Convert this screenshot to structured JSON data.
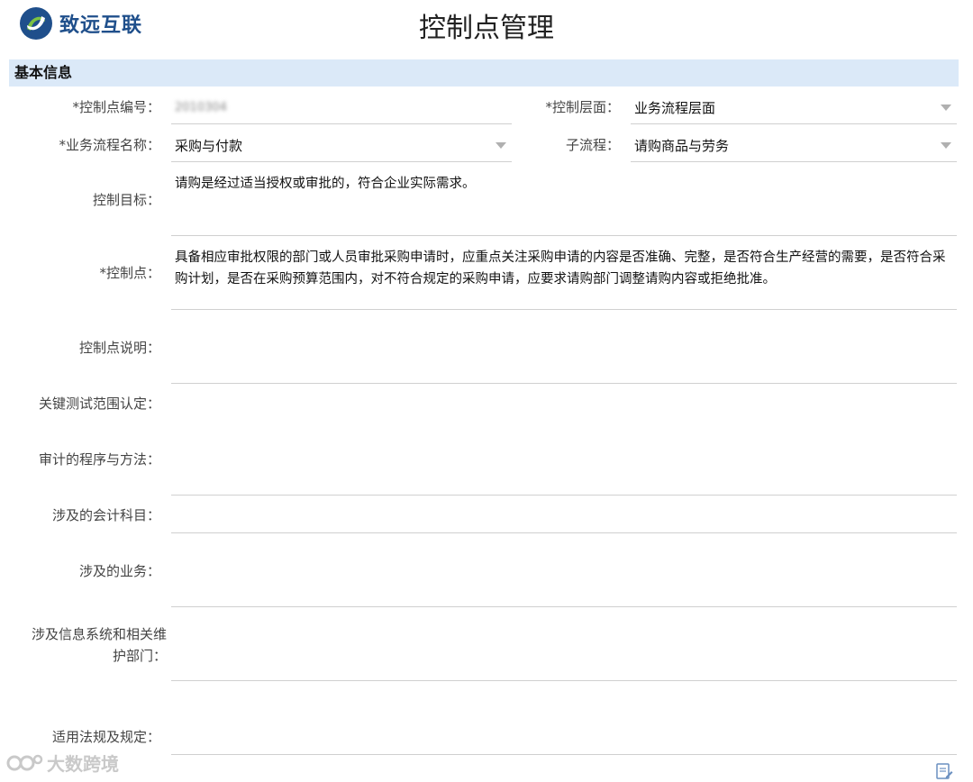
{
  "header": {
    "logo_text": "致远互联",
    "title": "控制点管理"
  },
  "section": {
    "title": "基本信息"
  },
  "form": {
    "control_point_no": {
      "label": "*控制点编号：",
      "value": "2010304"
    },
    "control_level": {
      "label": "*控制层面：",
      "value": "业务流程层面"
    },
    "process_name": {
      "label": "*业务流程名称：",
      "value": "采购与付款"
    },
    "sub_process": {
      "label": "子流程：",
      "value": "请购商品与劳务"
    },
    "control_objective": {
      "label": "控制目标：",
      "value": "请购是经过适当授权或审批的，符合企业实际需求。"
    },
    "control_point": {
      "label": "*控制点：",
      "value": "具备相应审批权限的部门或人员审批采购申请时，应重点关注采购申请的内容是否准确、完整，是否符合生产经营的需要，是否符合采购计划，是否在采购预算范围内，对不符合规定的采购申请，应要求请购部门调整请购内容或拒绝批准。"
    },
    "control_point_desc": {
      "label": "控制点说明：",
      "value": ""
    },
    "key_test_scope": {
      "label": "关键测试范围认定：",
      "value": ""
    },
    "audit_procedure": {
      "label": "审计的程序与方法：",
      "value": ""
    },
    "accounting_subjects": {
      "label": "涉及的会计科目：",
      "value": ""
    },
    "related_business": {
      "label": "涉及的业务：",
      "value": ""
    },
    "info_system_line1": "涉及信息系统和相关维",
    "info_system_line2": "护部门：",
    "info_system_value": "",
    "regulations": {
      "label": "适用法规及规定：",
      "value": ""
    }
  },
  "watermark": {
    "text": "大数跨境"
  },
  "icons": {
    "logo": "logo-swirl-icon",
    "dropdown": "chevron-down-icon",
    "edit": "edit-icon",
    "watermark": "watermark-logo-icon"
  },
  "colors": {
    "section_bg": "#dbe9f8",
    "logo_text": "#1f4f8b",
    "border": "#d0d0d0"
  }
}
